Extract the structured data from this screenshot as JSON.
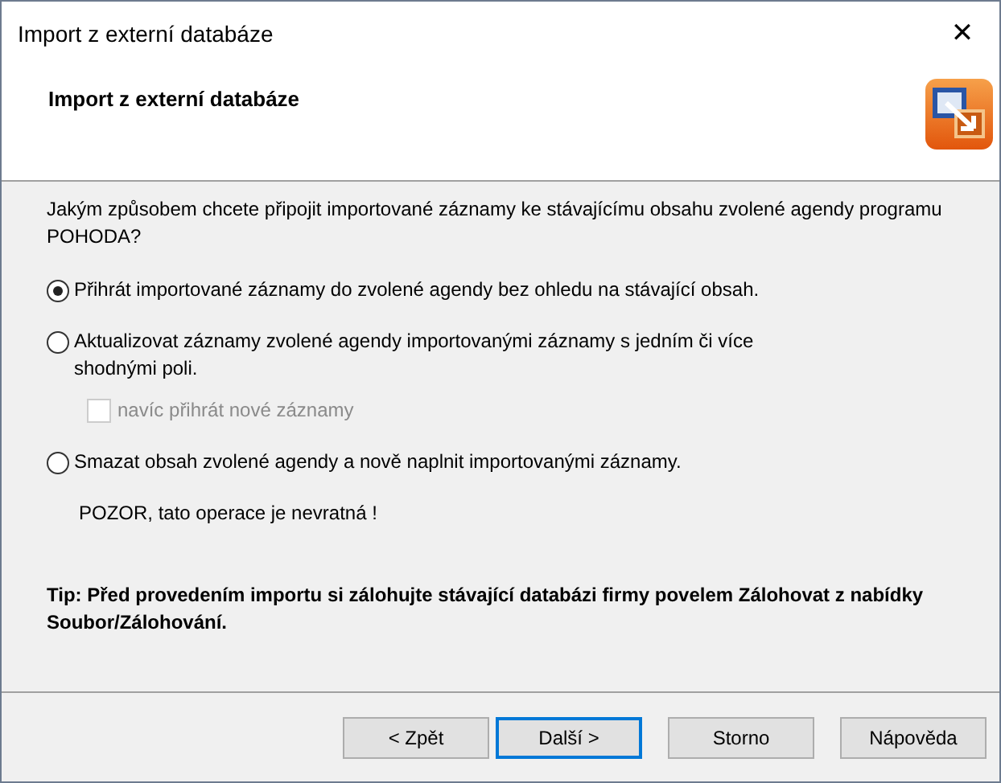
{
  "window": {
    "title": "Import z externí databáze",
    "close": "✕"
  },
  "header": {
    "title": "Import z externí databáze"
  },
  "question": "Jakým způsobem chcete připojit importované záznamy ke stávajícímu obsahu zvolené agendy programu POHODA?",
  "options": [
    {
      "kind": "radio",
      "label": "Přihrát importované záznamy do zvolené agendy bez ohledu na stávající obsah.",
      "selected": true,
      "disabled": false
    },
    {
      "kind": "radio",
      "label": "Aktualizovat záznamy zvolené agendy importovanými záznamy s jedním či více shodnými poli.",
      "selected": false,
      "disabled": false
    },
    {
      "kind": "checkbox",
      "label": "navíc přihrát nové záznamy",
      "checked": false,
      "disabled": true
    },
    {
      "kind": "radio",
      "label": "Smazat obsah zvolené agendy a nově naplnit importovanými záznamy.",
      "selected": false,
      "disabled": false
    },
    {
      "kind": "note",
      "label": "POZOR, tato operace je nevratná !"
    }
  ],
  "tip": "Tip: Před provedením importu si zálohujte stávající databázi firmy povelem Zálohovat z nabídky Soubor/Zálohování.",
  "buttons": [
    {
      "label": "< Zpět",
      "default": false
    },
    {
      "label": "Další >",
      "default": true
    },
    {
      "label": "Storno",
      "default": false
    },
    {
      "label": "Nápověda",
      "default": false
    }
  ]
}
